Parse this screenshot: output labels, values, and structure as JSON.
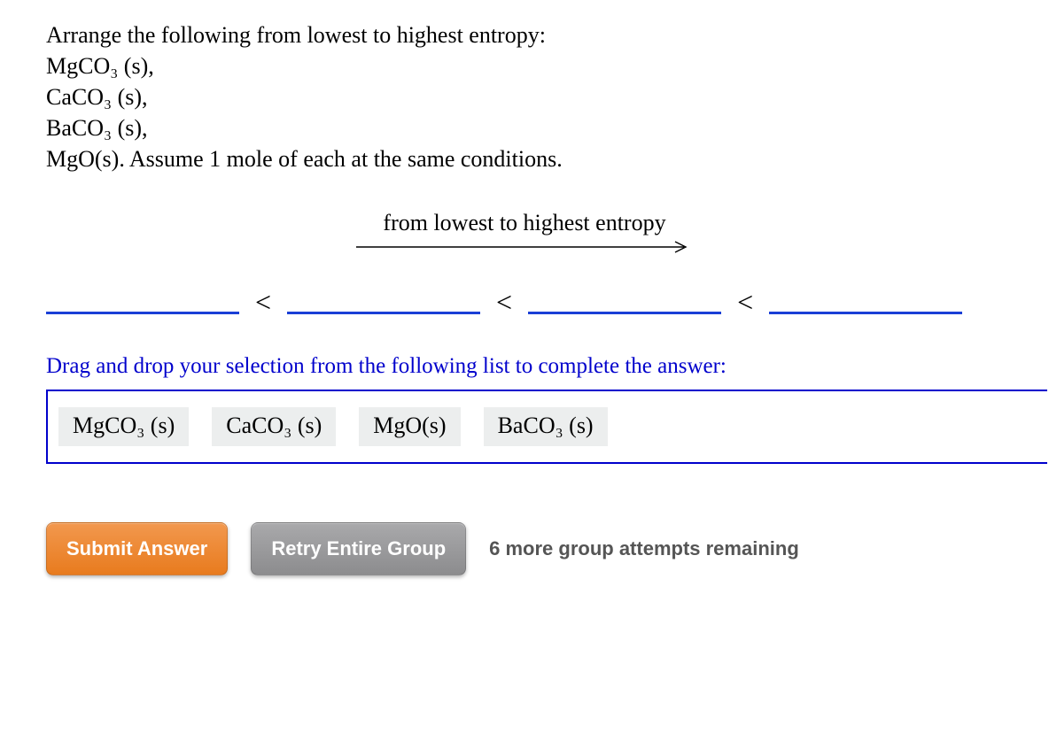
{
  "question": {
    "prompt": "Arrange the following from lowest to highest entropy:",
    "compounds": [
      "MgCO₃ (s),",
      "CaCO₃ (s),",
      "BaCO₃ (s),"
    ],
    "last_line": "MgO(s). Assume 1 mole of each at the same conditions."
  },
  "arrow_label": "from lowest to highest entropy",
  "lt_symbol": "<",
  "instruction": "Drag and drop your selection from the following list to complete the answer:",
  "options": [
    "MgCO₃ (s)",
    "CaCO₃ (s)",
    "MgO(s)",
    "BaCO₃ (s)"
  ],
  "buttons": {
    "submit": "Submit Answer",
    "retry": "Retry Entire Group"
  },
  "attempts_text": "6 more group attempts remaining"
}
